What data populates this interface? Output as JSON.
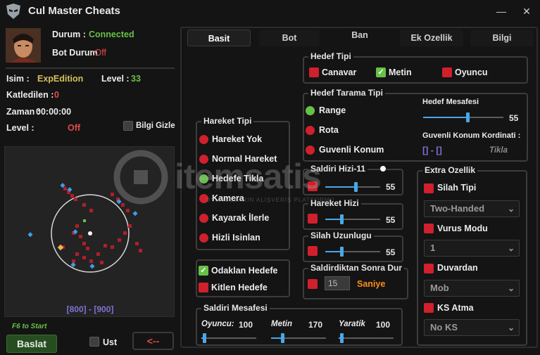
{
  "app": {
    "title": "Cul Master Cheats",
    "minimize": "—",
    "close": "✕"
  },
  "colors": {
    "accent": "#4aa7e8",
    "red": "#d0202c",
    "green": "#66c147",
    "yellow": "#d4c15a",
    "orange": "#ff8c1a"
  },
  "status": {
    "durum_label": "Durum :",
    "durum_value": "Connected",
    "bot_label": "Bot Durum",
    "bot_value": ":Off",
    "isim_label": "Isim :",
    "isim_value": "ExpEdition",
    "level_label": "Level :",
    "level_value": "33",
    "katledilen_label": "Katledilen :",
    "katledilen_value": "0",
    "zaman_label": "Zaman :",
    "zaman_value": "00:00:00",
    "level2_label": "Level :",
    "level2_value": "Off",
    "bilgi_gizle": "Bilgi Gizle"
  },
  "map": {
    "coords": "[800] - [900]"
  },
  "bottom": {
    "f6_hint": "F6 to Start",
    "start": "Baslat",
    "ust": "Ust",
    "arrow": "<--"
  },
  "tabs": [
    {
      "label": "Basit"
    },
    {
      "label": "Bot"
    },
    {
      "label": "Ban"
    },
    {
      "label": "Ek Ozellik"
    },
    {
      "label": "Bilgi"
    }
  ],
  "hedef_tipi": {
    "title": "Hedef Tipi",
    "canavar": "Canavar",
    "metin": "Metin",
    "oyuncu": "Oyuncu"
  },
  "hedef_tarama": {
    "title": "Hedef Tarama Tipi",
    "range": "Range",
    "rota": "Rota",
    "guvenli": "Guvenli Konum",
    "mesafe_label": "Hedef Mesafesi",
    "mesafe_value": "55",
    "mesafe_level": 0.55,
    "konum_label": "Guvenli Konum Kordinati :",
    "konum_value": "[] - []",
    "tikla": "Tikla"
  },
  "hareket_tipi": {
    "title": "Hareket Tipi",
    "items": [
      "Hareket Yok",
      "Normal Hareket",
      "Hedefe Tikla",
      "Kamera",
      "Kayarak İlerle",
      "Hizli Isinlan"
    ]
  },
  "odaklan": {
    "odaklan": "Odaklan Hedefe",
    "kitlen": "Kitlen Hedefe"
  },
  "saldiri_hizi": {
    "title": "Saldiri Hizi-11",
    "value": "55",
    "level": 0.55
  },
  "hareket_hizi": {
    "title": "Hareket Hizi",
    "value": "55",
    "level": 0.3
  },
  "silah_uzunlugu": {
    "title": "Silah Uzunlugu",
    "value": "55",
    "level": 0.3
  },
  "saldirdiktan": {
    "title": "Saldirdiktan Sonra Dur",
    "input": "15",
    "unit": "Saniye"
  },
  "extra": {
    "title": "Extra Ozellik",
    "silah_tipi": "Silah Tipi",
    "silah_combo": "Two-Handed",
    "vurus_modu": "Vurus Modu",
    "vurus_combo": "1",
    "duvardan": "Duvardan",
    "duvardan_combo": "Mob",
    "ks_atma": "KS Atma",
    "ks_combo": "No KS",
    "chevron": "⌄"
  },
  "saldiri_mesafesi": {
    "title": "Saldiri Mesafesi",
    "oyuncu_label": "Oyuncu:",
    "oyuncu_value": "100",
    "oyuncu_level": 0.05,
    "metin_label": "Metin",
    "metin_value": "170",
    "metin_level": 0.2,
    "yaratik_label": "Yaratik",
    "yaratik_value": "100",
    "yaratik_level": 0.05
  },
  "watermark": "itemsatis",
  "watermark_sub": "OYUNCULARIN ALIŞVERİŞ PLATFORMU"
}
